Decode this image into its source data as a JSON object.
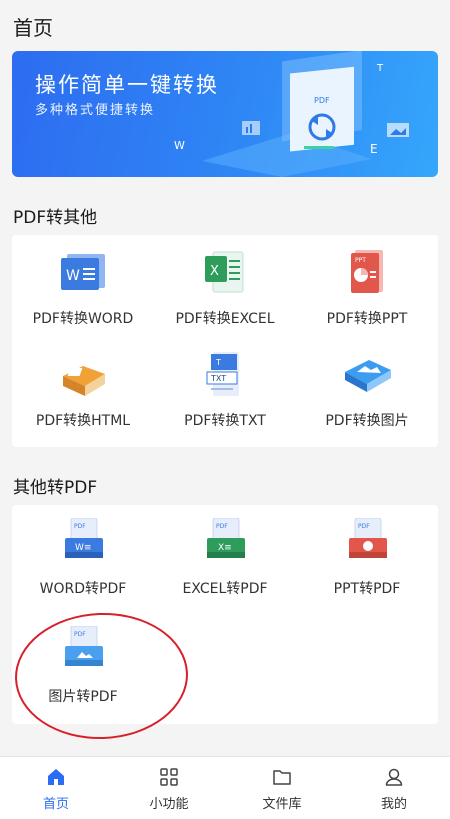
{
  "header": {
    "title": "首页"
  },
  "banner": {
    "title": "操作简单一键转换",
    "subtitle": "多种格式便捷转换",
    "art_letters": [
      "PDF",
      "W",
      "E",
      "T"
    ]
  },
  "section_pdf_to_other": {
    "title": "PDF转其他",
    "tools": [
      {
        "label": "PDF转换WORD",
        "icon": "word-doc-icon"
      },
      {
        "label": "PDF转换EXCEL",
        "icon": "excel-doc-icon"
      },
      {
        "label": "PDF转换PPT",
        "icon": "ppt-doc-icon"
      },
      {
        "label": "PDF转换HTML",
        "icon": "html-book-icon"
      },
      {
        "label": "PDF转换TXT",
        "icon": "txt-doc-icon"
      },
      {
        "label": "PDF转换图片",
        "icon": "image-doc-icon"
      }
    ]
  },
  "section_other_to_pdf": {
    "title": "其他转PDF",
    "tools": [
      {
        "label": "WORD转PDF",
        "icon": "word-to-pdf-icon"
      },
      {
        "label": "EXCEL转PDF",
        "icon": "excel-to-pdf-icon"
      },
      {
        "label": "PPT转PDF",
        "icon": "ppt-to-pdf-icon"
      },
      {
        "label": "图片转PDF",
        "icon": "image-to-pdf-icon"
      }
    ]
  },
  "tabbar": {
    "tabs": [
      {
        "label": "首页",
        "icon": "home-icon",
        "active": true
      },
      {
        "label": "小功能",
        "icon": "grid-icon",
        "active": false
      },
      {
        "label": "文件库",
        "icon": "folder-icon",
        "active": false
      },
      {
        "label": "我的",
        "icon": "user-icon",
        "active": false
      }
    ]
  },
  "colors": {
    "accent": "#2a6df4",
    "highlight_circle": "#d8202a",
    "word": "#3b7be0",
    "excel": "#2e9d5b",
    "ppt": "#e2574c"
  }
}
